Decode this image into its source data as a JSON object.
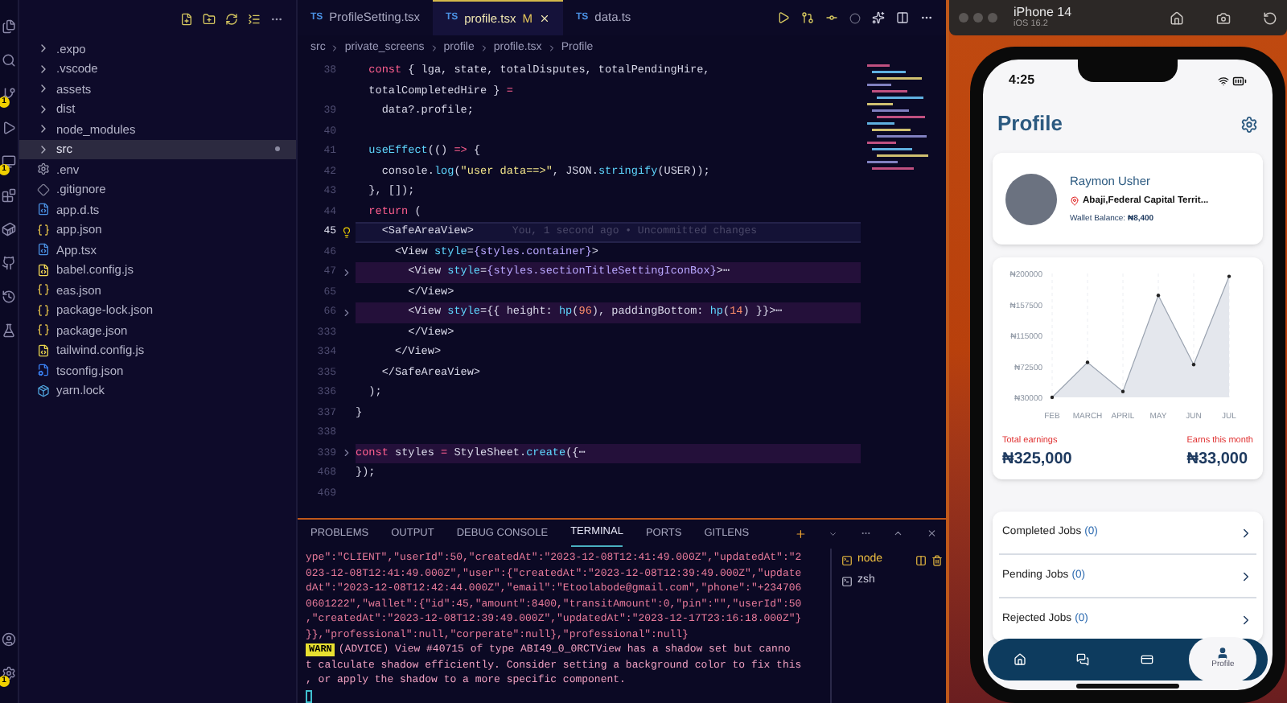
{
  "activity_bar": {
    "items": [
      {
        "kind": "files"
      },
      {
        "kind": "search"
      },
      {
        "kind": "source",
        "badge": "1"
      },
      {
        "kind": "run"
      },
      {
        "kind": "remote",
        "badge": "1"
      },
      {
        "kind": "extensions"
      },
      {
        "kind": "docker"
      },
      {
        "kind": "github"
      },
      {
        "kind": "history"
      },
      {
        "kind": "testing"
      }
    ],
    "bottom": [
      {
        "kind": "account"
      },
      {
        "kind": "settings",
        "badge": "1"
      }
    ]
  },
  "explorer": {
    "items": [
      {
        "kind": "folder",
        "name": ".expo",
        "selected": false
      },
      {
        "kind": "folder",
        "name": ".vscode",
        "selected": false
      },
      {
        "kind": "folder",
        "name": "assets",
        "selected": false
      },
      {
        "kind": "folder",
        "name": "dist",
        "selected": false
      },
      {
        "kind": "folder",
        "name": "node_modules",
        "selected": false
      },
      {
        "kind": "folder",
        "name": "src",
        "selected": true,
        "modified": true
      },
      {
        "kind": "env",
        "name": ".env",
        "selected": false
      },
      {
        "kind": "git",
        "name": ".gitignore",
        "selected": false
      },
      {
        "kind": "ts",
        "name": "app.d.ts",
        "selected": false
      },
      {
        "kind": "json",
        "name": "app.json",
        "selected": false
      },
      {
        "kind": "ts",
        "name": "App.tsx",
        "selected": false
      },
      {
        "kind": "babel",
        "name": "babel.config.js",
        "selected": false
      },
      {
        "kind": "json",
        "name": "eas.json",
        "selected": false
      },
      {
        "kind": "json",
        "name": "package-lock.json",
        "selected": false
      },
      {
        "kind": "json",
        "name": "package.json",
        "selected": false
      },
      {
        "kind": "js",
        "name": "tailwind.config.js",
        "selected": false
      },
      {
        "kind": "tsconfig",
        "name": "tsconfig.json",
        "selected": false
      },
      {
        "kind": "yarn",
        "name": "yarn.lock",
        "selected": false
      }
    ]
  },
  "editor": {
    "tabs": [
      {
        "icon": "TS",
        "label": "ProfileSetting.tsx",
        "selected": false
      },
      {
        "icon": "TS",
        "label": "profile.tsx",
        "modified": "M",
        "selected": true
      },
      {
        "icon": "TS",
        "label": "data.ts",
        "selected": false
      }
    ],
    "breadcrumb": [
      "src",
      "private_screens",
      "profile",
      "profile.tsx",
      "Profile"
    ],
    "lines": [
      {
        "number": "38",
        "tokens": [
          {
            "kind": "kw",
            "text": "  const"
          },
          {
            "kind": "plain",
            "text": " { lga, state, totalDisputes, totalPendingHire,"
          }
        ]
      },
      {
        "tokens": [
          {
            "kind": "plain",
            "text": "  totalCompletedHire } "
          },
          {
            "kind": "kw",
            "text": "="
          }
        ]
      },
      {
        "number": "39",
        "tokens": [
          {
            "kind": "plain",
            "text": "    data?.profile;"
          }
        ]
      },
      {
        "number": "40"
      },
      {
        "number": "41",
        "tokens": [
          {
            "kind": "fn",
            "text": "  useEffect"
          },
          {
            "kind": "plain",
            "text": "(() "
          },
          {
            "kind": "kw",
            "text": "=>"
          },
          {
            "kind": "plain",
            "text": " {"
          }
        ]
      },
      {
        "number": "42",
        "tokens": [
          {
            "kind": "plain",
            "text": "    console."
          },
          {
            "kind": "fn",
            "text": "log"
          },
          {
            "kind": "plain",
            "text": "("
          },
          {
            "kind": "str",
            "text": "\"user data==>\""
          },
          {
            "kind": "plain",
            "text": ", JSON."
          },
          {
            "kind": "fn",
            "text": "stringify"
          },
          {
            "kind": "plain",
            "text": "(USER));"
          }
        ]
      },
      {
        "number": "43",
        "tokens": [
          {
            "kind": "plain",
            "text": "  }, []);"
          }
        ]
      },
      {
        "number": "44",
        "tokens": [
          {
            "kind": "kw",
            "text": "  return"
          },
          {
            "kind": "plain",
            "text": " ("
          }
        ]
      },
      {
        "number": "45",
        "current": true,
        "blame": "You, 1 second ago • Uncommitted changes",
        "tokens": [
          {
            "kind": "plain",
            "text": "    <SafeAreaView>"
          }
        ]
      },
      {
        "number": "46",
        "tokens": [
          {
            "kind": "plain",
            "text": "      <View "
          },
          {
            "kind": "attr",
            "text": "style"
          },
          {
            "kind": "plain",
            "text": "="
          },
          {
            "kind": "var",
            "text": "{styles.container}"
          },
          {
            "kind": "plain",
            "text": ">"
          }
        ]
      },
      {
        "number": "47",
        "folded": true,
        "tokens": [
          {
            "kind": "plain",
            "text": "        <View "
          },
          {
            "kind": "attr",
            "text": "style"
          },
          {
            "kind": "plain",
            "text": "="
          },
          {
            "kind": "var",
            "text": "{styles.sectionTitleSettingIconBox}"
          },
          {
            "kind": "plain",
            "text": ">⋯"
          }
        ]
      },
      {
        "number": "65",
        "tokens": [
          {
            "kind": "plain",
            "text": "        </View>"
          }
        ]
      },
      {
        "number": "66",
        "folded": true,
        "tokens": [
          {
            "kind": "plain",
            "text": "        <View "
          },
          {
            "kind": "attr",
            "text": "style"
          },
          {
            "kind": "plain",
            "text": "={{ height: "
          },
          {
            "kind": "fn",
            "text": "hp"
          },
          {
            "kind": "plain",
            "text": "("
          },
          {
            "kind": "num",
            "text": "96"
          },
          {
            "kind": "plain",
            "text": "), paddingBottom: "
          },
          {
            "kind": "fn",
            "text": "hp"
          },
          {
            "kind": "plain",
            "text": "("
          },
          {
            "kind": "num",
            "text": "14"
          },
          {
            "kind": "plain",
            "text": ") }}>⋯"
          }
        ]
      },
      {
        "number": "333",
        "tokens": [
          {
            "kind": "plain",
            "text": "        </View>"
          }
        ]
      },
      {
        "number": "334",
        "tokens": [
          {
            "kind": "plain",
            "text": "      </View>"
          }
        ]
      },
      {
        "number": "335",
        "tokens": [
          {
            "kind": "plain",
            "text": "    </SafeAreaView>"
          }
        ]
      },
      {
        "number": "336",
        "tokens": [
          {
            "kind": "plain",
            "text": "  );"
          }
        ]
      },
      {
        "number": "337",
        "tokens": [
          {
            "kind": "plain",
            "text": "}"
          }
        ]
      },
      {
        "number": "338"
      },
      {
        "number": "339",
        "folded": true,
        "tokens": [
          {
            "kind": "kw",
            "text": "const"
          },
          {
            "kind": "plain",
            "text": " styles "
          },
          {
            "kind": "kw",
            "text": "="
          },
          {
            "kind": "plain",
            "text": " StyleSheet."
          },
          {
            "kind": "fn",
            "text": "create"
          },
          {
            "kind": "plain",
            "text": "({⋯"
          }
        ]
      },
      {
        "number": "468",
        "tokens": [
          {
            "kind": "plain",
            "text": "});"
          }
        ]
      },
      {
        "number": "469"
      }
    ]
  },
  "panel": {
    "tabs": [
      {
        "label": "PROBLEMS",
        "selected": false
      },
      {
        "label": "OUTPUT",
        "selected": false
      },
      {
        "label": "DEBUG CONSOLE",
        "selected": false
      },
      {
        "label": "TERMINAL",
        "selected": true
      },
      {
        "label": "PORTS",
        "selected": false
      },
      {
        "label": "GITLENS",
        "selected": false
      }
    ],
    "terminal_lines": [
      {
        "kind": "log",
        "text": "ype\":\"CLIENT\",\"userId\":50,\"createdAt\":\"2023-12-08T12:41:49.000Z\",\"updatedAt\":\"2"
      },
      {
        "kind": "log",
        "text": "023-12-08T12:41:49.000Z\",\"user\":{\"createdAt\":\"2023-12-08T12:39:49.000Z\",\"update"
      },
      {
        "kind": "log",
        "text": "dAt\":\"2023-12-08T12:42:44.000Z\",\"email\":\"Etoolabode@gmail.com\",\"phone\":\"+234706"
      },
      {
        "kind": "log",
        "text": "0601222\",\"wallet\":{\"id\":45,\"amount\":8400,\"transitAmount\":0,\"pin\":\"\",\"userId\":50"
      },
      {
        "kind": "log",
        "text": ",\"createdAt\":\"2023-12-08T12:39:49.000Z\",\"updatedAt\":\"2023-12-17T23:16:18.000Z\"}"
      },
      {
        "kind": "log",
        "text": "}},\"professional\":null,\"corperate\":null},\"professional\":null}"
      },
      {
        "kind": "warn",
        "badge": "WARN",
        "text": "(ADVICE) View #40715 of type ABI49_0_0RCTView has a shadow set but canno"
      },
      {
        "kind": "warn_cont",
        "text": "t calculate shadow efficiently. Consider setting a background color to fix this"
      },
      {
        "kind": "warn_cont",
        "text": ", or apply the shadow to a more specific component."
      }
    ],
    "terminals": [
      {
        "name": "node",
        "selected": true
      },
      {
        "name": "zsh",
        "selected": false
      }
    ]
  },
  "simulator": {
    "device": "iPhone 14",
    "os": "iOS 16.2"
  },
  "phone": {
    "time": "4:25",
    "title": "Profile",
    "profile": {
      "name": "Raymon Usher",
      "location": "Abaji,Federal Capital Territ...",
      "wallet": "Wallet Balance: **₦8,400**"
    },
    "chart_data": {
      "type": "area",
      "categories": [
        "FEB",
        "MARCH",
        "APRIL",
        "MAY",
        "JUN",
        "JUL"
      ],
      "series": [
        {
          "color": "#e4e7ed",
          "values": [
            30000,
            78000,
            38000,
            170000,
            75000,
            196000
          ]
        }
      ],
      "ylim": [
        30000,
        200000
      ],
      "grid": true,
      "yticks": [
        {
          "value": 30000,
          "label": "₦30000"
        },
        {
          "value": 72500,
          "label": "₦72500"
        },
        {
          "value": 115000,
          "label": "₦115000"
        },
        {
          "value": 157500,
          "label": "₦157500"
        },
        {
          "value": 200000,
          "label": "₦200000"
        }
      ]
    },
    "totals": [
      {
        "label": "Total earnings",
        "amount": "₦325,000"
      },
      {
        "label": "Earns this month",
        "amount": "₦33,000"
      }
    ],
    "jobs": [
      {
        "label": "Completed Jobs",
        "count": "(0)"
      },
      {
        "label": "Pending Jobs",
        "count": "(0)"
      },
      {
        "label": "Rejected Jobs",
        "count": "(0)"
      }
    ],
    "tabbar": [
      {
        "kind": "home",
        "selected": false
      },
      {
        "kind": "chat",
        "selected": false
      },
      {
        "kind": "wallet",
        "selected": false
      },
      {
        "kind": "profile",
        "label": "Profile",
        "selected": true
      }
    ]
  }
}
